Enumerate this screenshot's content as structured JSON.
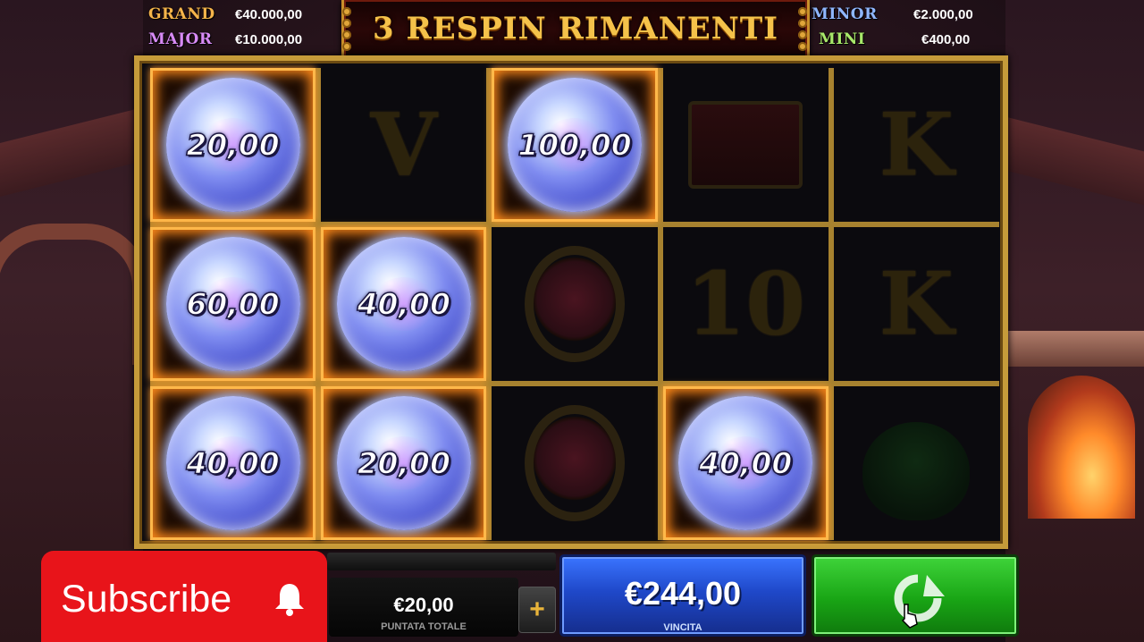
{
  "jackpots": {
    "grand": {
      "label": "GRAND",
      "value": "€40.000,00"
    },
    "major": {
      "label": "MAJOR",
      "value": "€10.000,00"
    },
    "minor": {
      "label": "MINOR",
      "value": "€2.000,00"
    },
    "mini": {
      "label": "MINI",
      "value": "€400,00"
    }
  },
  "banner": {
    "title": "3 RESPIN RIMANENTI"
  },
  "grid": {
    "row1": {
      "c1": "20,00",
      "c2": "V",
      "c3": "100,00",
      "c4": "chest",
      "c5": "K"
    },
    "row2": {
      "c1": "60,00",
      "c2": "40,00",
      "c3": "ring",
      "c4": "10",
      "c5": "K"
    },
    "row3": {
      "c1": "40,00",
      "c2": "20,00",
      "c3": "ring",
      "c4": "40,00",
      "c5": "cauldron"
    }
  },
  "bet": {
    "amount": "€20,00",
    "label": "PUNTATA TOTALE",
    "plus": "+"
  },
  "win": {
    "amount": "€244,00",
    "label": "VINCITA"
  },
  "spin": {
    "icon": "respin-arrow-icon"
  },
  "overlay": {
    "subscribe_label": "Subscribe",
    "icon": "bell-icon"
  },
  "colors": {
    "orb_glow": "#ffb84a",
    "win_blue": "#1f48c9",
    "spin_green": "#19a515",
    "subscribe_red": "#e8141a",
    "gold": "#c59b3a"
  }
}
